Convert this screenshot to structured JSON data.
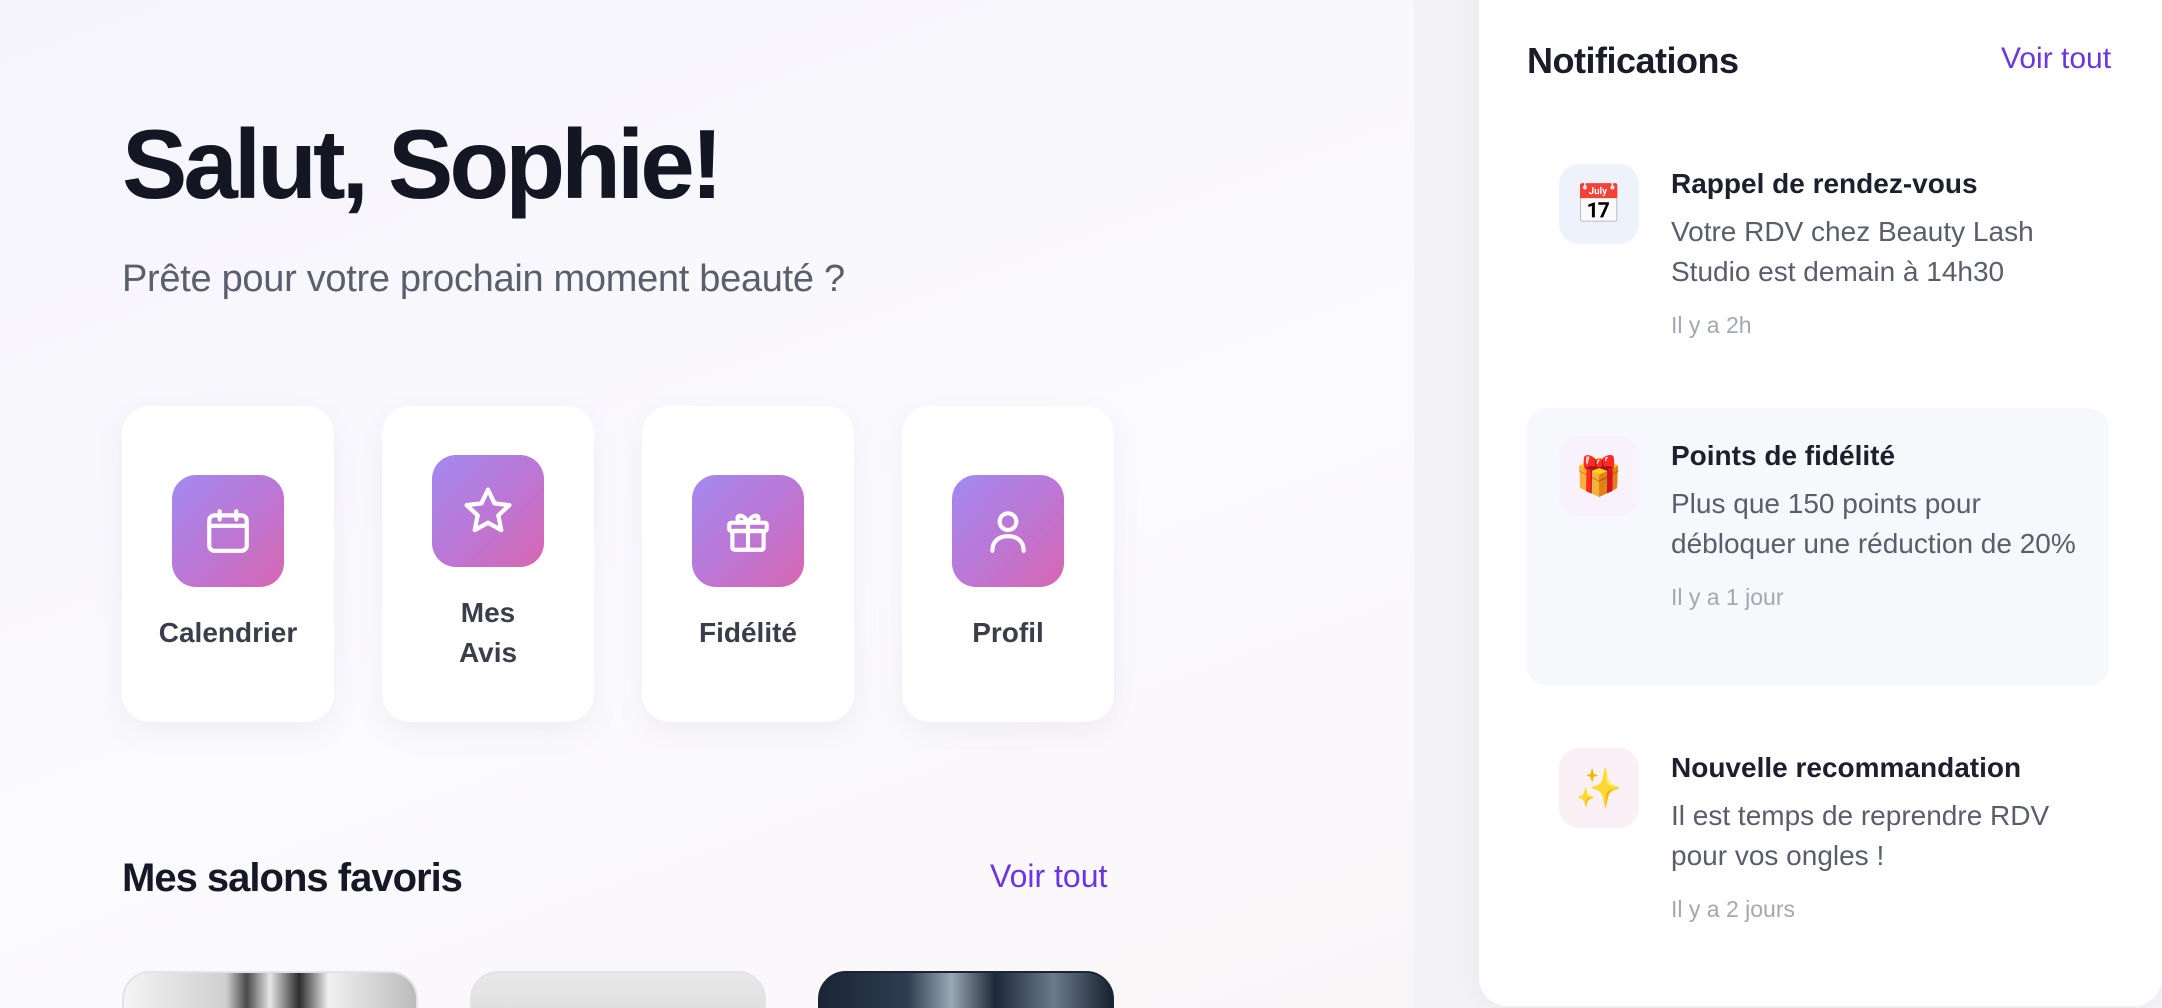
{
  "greeting": "Salut, Sophie!",
  "subtitle": "Prête pour votre prochain moment beauté ?",
  "quick_actions": [
    {
      "label": "Calendrier",
      "icon": "calendar-icon"
    },
    {
      "label": "Mes Avis",
      "icon": "star-icon"
    },
    {
      "label": "Fidélité",
      "icon": "gift-icon"
    },
    {
      "label": "Profil",
      "icon": "user-icon"
    }
  ],
  "favorites": {
    "title": "Mes salons favoris",
    "see_all": "Voir tout"
  },
  "notifications": {
    "title": "Notifications",
    "see_all": "Voir tout",
    "items": [
      {
        "icon": "calendar-emoji-icon",
        "glyph": "📅",
        "title": "Rappel de rendez-vous",
        "body": "Votre RDV chez Beauty Lash Studio est demain à 14h30",
        "time": "Il y a 2h"
      },
      {
        "icon": "gift-emoji-icon",
        "glyph": "🎁",
        "title": "Points de fidélité",
        "body": "Plus que 150 points pour débloquer une réduction de 20%",
        "time": "Il y a 1 jour"
      },
      {
        "icon": "sparkles-emoji-icon",
        "glyph": "✨",
        "title": "Nouvelle recommandation",
        "body": "Il est temps de reprendre RDV pour vos ongles !",
        "time": "Il y a 2 jours"
      }
    ]
  },
  "colors": {
    "accent": "#6c35e0",
    "icon_gradient_start": "#a289f0",
    "icon_gradient_end": "#d866b0"
  }
}
